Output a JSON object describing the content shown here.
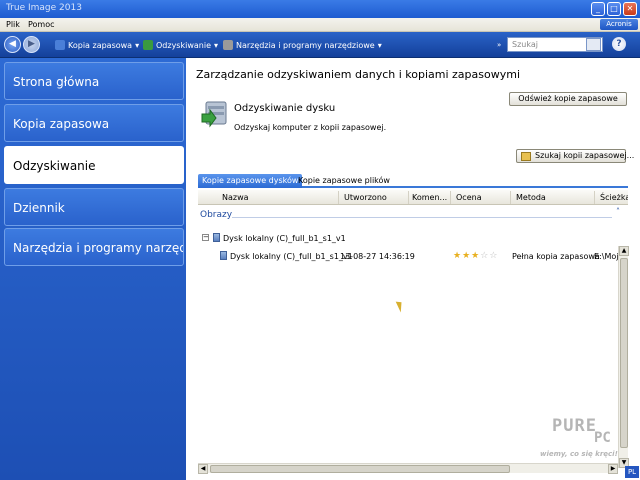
{
  "window": {
    "title": "True Image 2013",
    "controls": {
      "minimize": "_",
      "maximize": "□",
      "close": "✕"
    }
  },
  "menu": {
    "items": [
      "Plik",
      "Pomoc"
    ],
    "logo": "Acronis"
  },
  "toolbar": {
    "back": "◀",
    "forward": "▶",
    "items": [
      {
        "label": "Kopia zapasowa",
        "icon": "backup-icon",
        "color": "#4a7fd8"
      },
      {
        "label": "Odzyskiwanie",
        "icon": "recovery-icon",
        "color": "#3a9a40"
      },
      {
        "label": "Narzędzia i programy narzędziowe",
        "icon": "tools-icon",
        "color": "#8a8a8a"
      }
    ],
    "search_placeholder": "Szukaj",
    "help": "?"
  },
  "sidebar": {
    "items": [
      {
        "label": "Strona główna"
      },
      {
        "label": "Kopia zapasowa"
      },
      {
        "label": "Odzyskiwanie"
      },
      {
        "label": "Dziennik"
      },
      {
        "label": "Narzędzia i programy narzędziowe"
      }
    ],
    "active_index": 2
  },
  "main": {
    "title": "Zarządzanie odzyskiwaniem danych i kopiami zapasowymi",
    "refresh_button": "Odśwież kopie zapasowe",
    "section_title": "Odzyskiwanie dysku",
    "section_desc": "Odzyskaj komputer z kopii zapasowej.",
    "find_button": "Szukaj kopii zapasowej...",
    "tabs": [
      "Kopie zapasowe dysków",
      "Kopie zapasowe plików"
    ],
    "columns": [
      "Nazwa",
      "Utworzono",
      "Komen...",
      "Ocena",
      "Metoda",
      "Ścieżka"
    ],
    "group_label": "Obrazy",
    "parent_item": "Dysk lokalny (C)_full_b1_s1_v1",
    "row": {
      "name": "Dysk lokalny (C)_full_b1_s1_v1",
      "created": "13-08-27 14:36:19",
      "rating": 3,
      "rating_max": 5,
      "method": "Pełna kopia zapasowa",
      "path": "E:\\Moje ko"
    }
  },
  "watermark": {
    "brand": "PURE",
    "brand2": "PC",
    "tagline": "wiemy, co się kręci!"
  },
  "language": "PL"
}
